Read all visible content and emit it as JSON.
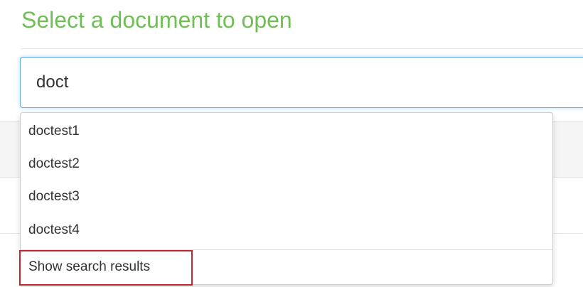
{
  "dialog": {
    "title": "Select a document to open"
  },
  "search": {
    "value": "doct"
  },
  "dropdown": {
    "items": [
      {
        "label": "doctest1"
      },
      {
        "label": "doctest2"
      },
      {
        "label": "doctest3"
      },
      {
        "label": "doctest4"
      }
    ],
    "show_results_label": "Show search results"
  },
  "colors": {
    "title": "#6fbf55",
    "input_focus_border": "#66afe9",
    "highlight_border": "#c0282f"
  }
}
